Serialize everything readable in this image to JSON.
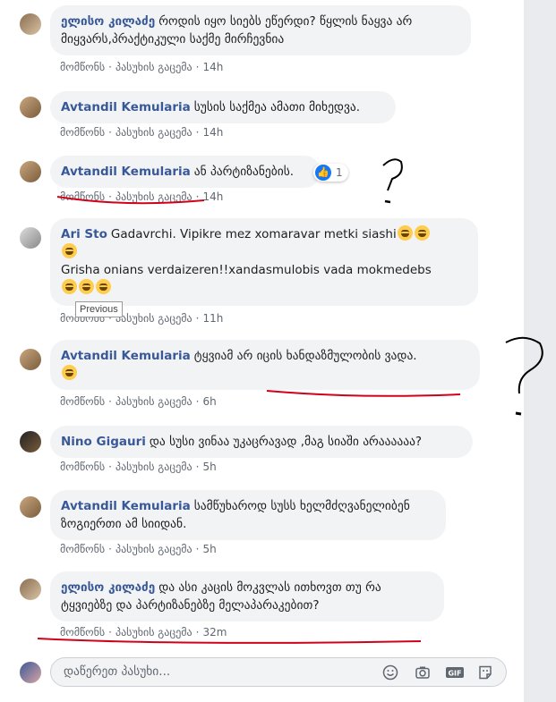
{
  "action_like": "მომწონს",
  "action_reply": "პასუხის გაცემა",
  "separator": "·",
  "comments": [
    {
      "author": "ელისო კილაძე",
      "text": "როდის იყო სიებს ეწერდი? წყლის ნაყვა არ მიყვარს,პრაქტიკული საქმე მირჩევნია",
      "time": "14h"
    },
    {
      "author": "Avtandil Kemularia",
      "text": "სუსის საქმეა ამათი მიხედვა.",
      "time": "14h"
    },
    {
      "author": "Avtandil Kemularia",
      "text": "ან პარტიზანების.",
      "time": "14h",
      "reaction_count": "1"
    },
    {
      "author": "Ari Sto",
      "text_line1": "Gadavrchi. Vipikre mez xomaravar metki siashi",
      "text_line3": "Grisha onians verdaizeren!!xandasmulobis vada mokmedebs",
      "time": "11h"
    },
    {
      "author": "Avtandil Kemularia",
      "text": "ტყვიამ არ იცის ხანდაზმულობის ვადა.",
      "time": "6h"
    },
    {
      "author": "Nino Gigauri",
      "text": "და სუსი ვინაა უკაცრავად ,მაგ სიაში არაააააა?",
      "time": "5h"
    },
    {
      "author": "Avtandil Kemularia",
      "text": "სამწუხაროდ სუსს ხელმძღვანელიბენ ზოგიერთი ამ სიიდან.",
      "time": "5h"
    },
    {
      "author": "ელისო კილაძე",
      "text": "და ასი კაცის მოკვლას ითხოვთ თუ რა ტყვიებზე და პარტიზანებზე მელაპარაკებით?",
      "time": "32m"
    }
  ],
  "tooltip": "Previous",
  "reply": {
    "placeholder": "დაწერეთ პასუხი..."
  },
  "icons": [
    "emoji-icon",
    "camera-icon",
    "gif-icon",
    "sticker-icon"
  ],
  "colors": {
    "author": "#385898",
    "bubble": "#f2f3f5",
    "ink": "#d0021b",
    "like": "#1877f2"
  }
}
